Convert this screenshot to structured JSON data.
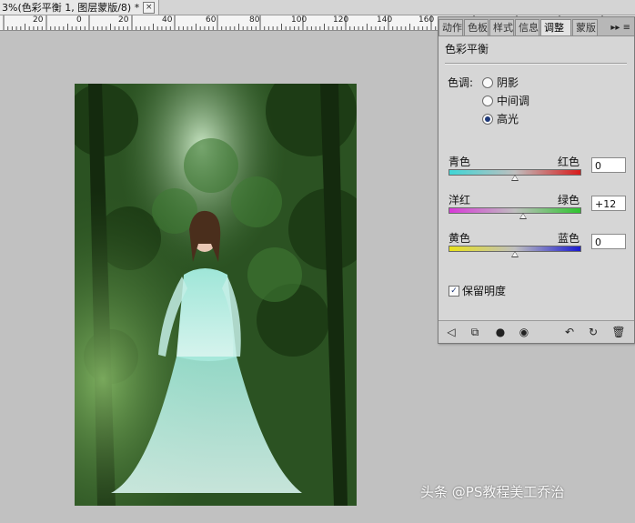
{
  "document_tab": {
    "title": "3%(色彩平衡 1, 图层蒙版/8) *",
    "close_glyph": "×"
  },
  "ruler": {
    "labels": [
      "20",
      "0",
      "20",
      "40",
      "60",
      "80",
      "100",
      "120",
      "140",
      "160"
    ]
  },
  "panel": {
    "tabs": [
      "动作",
      "色板",
      "样式",
      "信息",
      "调整",
      "蒙版"
    ],
    "active_tab": "调整",
    "menu_glyph": "▸▸ ≡",
    "title": "色彩平衡",
    "tone": {
      "label": "色调:",
      "options": [
        "阴影",
        "中间调",
        "高光"
      ],
      "selected": "高光"
    },
    "sliders": [
      {
        "left": "青色",
        "right": "红色",
        "value": "0",
        "level": 0
      },
      {
        "left": "洋红",
        "right": "绿色",
        "value": "+12",
        "level": 12
      },
      {
        "left": "黄色",
        "right": "蓝色",
        "value": "0",
        "level": 0
      }
    ],
    "preserve_luminosity": {
      "label": "保留明度",
      "checked": true
    }
  },
  "watermark": "头条 @PS教程美工乔治",
  "colors": {
    "cyan_red": [
      "#3fd6d6",
      "#d81b1b"
    ],
    "magenta_green": [
      "#d83ad8",
      "#2fc52f"
    ],
    "yellow_blue": [
      "#e8e21a",
      "#1a1ad0"
    ]
  }
}
